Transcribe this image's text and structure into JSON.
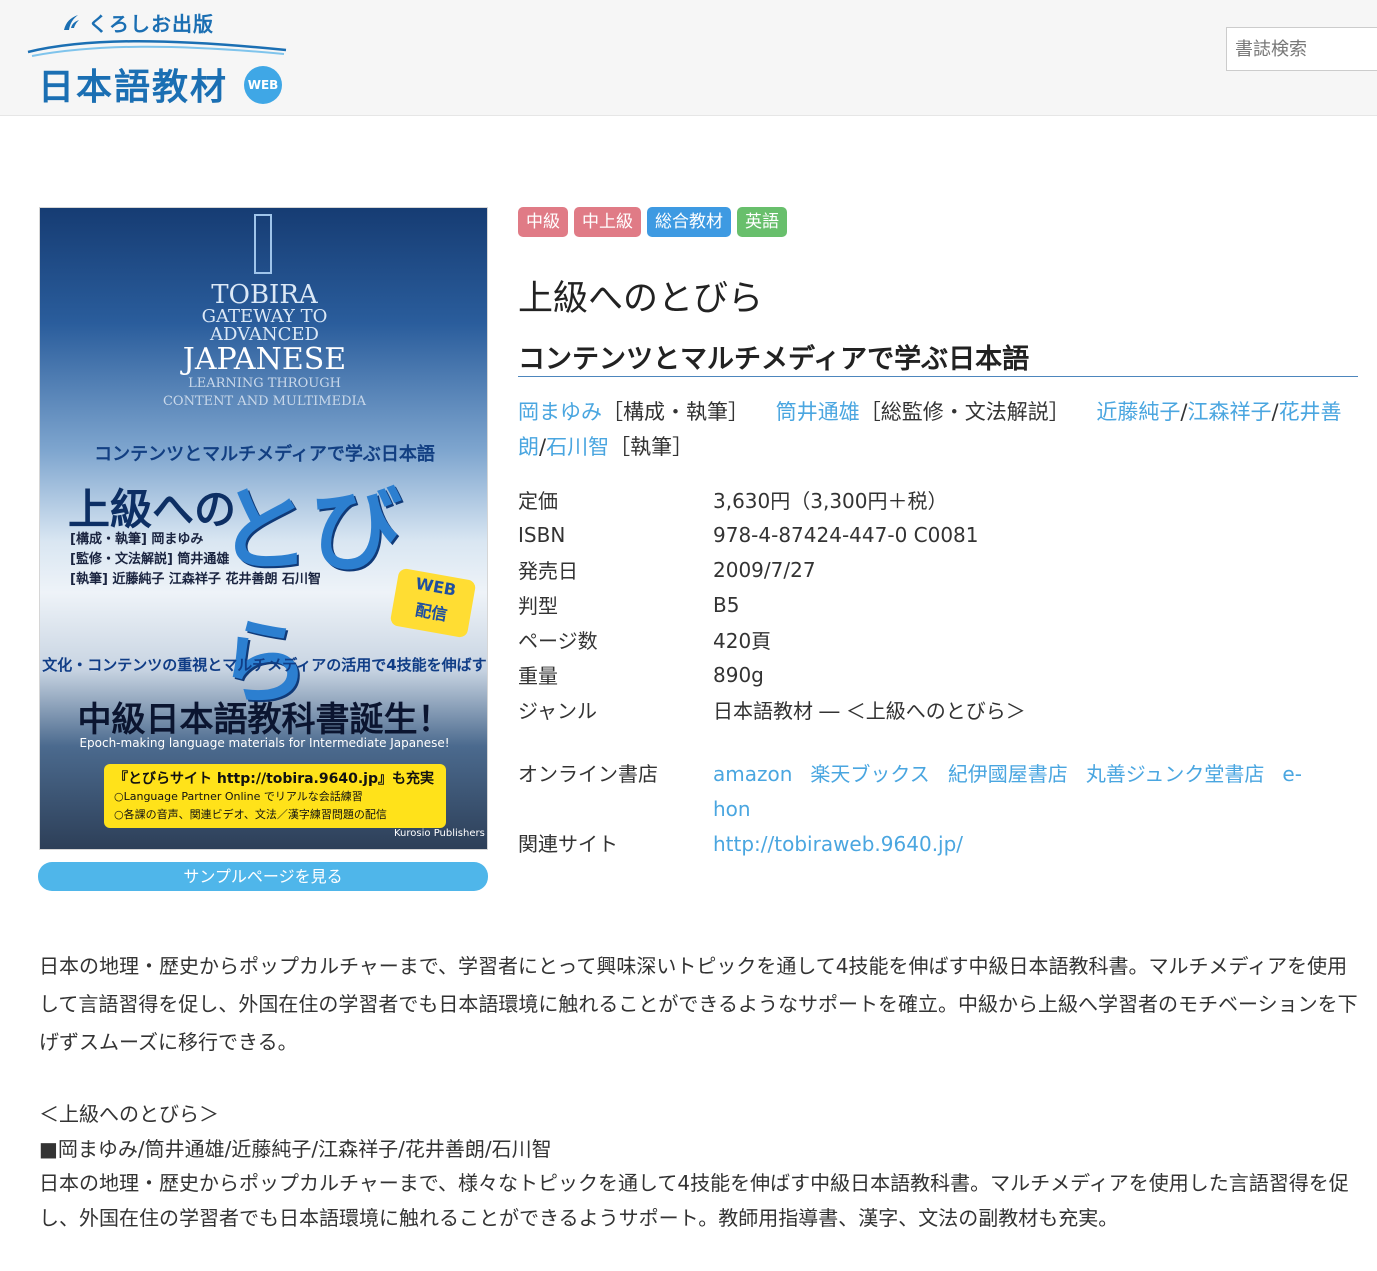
{
  "header": {
    "publisher": "くろしお出版",
    "site_name": "日本語教材",
    "web_badge": "WEB",
    "search_placeholder": "書誌検索"
  },
  "cover": {
    "en_line1": "TOBIRA",
    "en_line2": "GATEWAY TO",
    "en_line3": "ADVANCED",
    "en_line4": "JAPANESE",
    "en_line5": "LEARNING THROUGH",
    "en_line6": "CONTENT AND MULTIMEDIA",
    "subtitle": "コンテンツとマルチメディアで学ぶ日本語",
    "title_a": "上級への",
    "title_b": "とびら",
    "authors_1": "[構成・執筆] 岡まゆみ",
    "authors_2": "[監修・文法解説] 筒井通雄",
    "authors_3": "[執筆] 近藤純子 江森祥子 花井善朗 石川智",
    "web_badge_1": "WEB",
    "web_badge_2": "配信",
    "band": "文化・コンテンツの重視とマルチメディアの活用で4技能を伸ばす",
    "big": "中級日本語教科書誕生！",
    "big_en": "Epoch-making language materials for Intermediate Japanese!",
    "yellow_1": "『とびらサイト http://tobira.9640.jp』も充実",
    "yellow_2": "○Language Partner Online でリアルな会話練習",
    "yellow_3": "○各課の音声、関連ビデオ、文法／漢字練習問題の配信",
    "publisher": "Kurosio Publishers"
  },
  "sample_button": "サンプルページを見る",
  "tags": [
    {
      "label": "中級",
      "color": "#e07b86"
    },
    {
      "label": "中上級",
      "color": "#e07b86"
    },
    {
      "label": "総合教材",
      "color": "#3e9ae2"
    },
    {
      "label": "英語",
      "color": "#68bf6c"
    }
  ],
  "book": {
    "title": "上級へのとびら",
    "subtitle": "コンテンツとマルチメディアで学ぶ日本語"
  },
  "authors": {
    "a1": "岡まゆみ",
    "r1": "［構成・執筆］",
    "a2": "筒井通雄",
    "r2": "［総監修・文法解説］",
    "a3": "近藤純子",
    "a4": "江森祥子",
    "a5": "花井善朗",
    "a6": "石川智",
    "r3": "［執筆］",
    "sep": "/"
  },
  "specs": {
    "price_label": "定価",
    "price": "3,630円（3,300円＋税）",
    "isbn_label": "ISBN",
    "isbn": "978-4-87424-447-0 C0081",
    "date_label": "発売日",
    "date": "2009/7/27",
    "size_label": "判型",
    "size": "B5",
    "pages_label": "ページ数",
    "pages": "420頁",
    "weight_label": "重量",
    "weight": "890g",
    "genre_label": "ジャンル",
    "genre": "日本語教材 ― ＜上級へのとびら＞"
  },
  "online": {
    "label": "オンライン書店",
    "stores": [
      "amazon",
      "楽天ブックス",
      "紀伊國屋書店",
      "丸善ジュンク堂書店",
      "e-hon"
    ]
  },
  "related": {
    "label": "関連サイト",
    "url": "http://tobiraweb.9640.jp/"
  },
  "description": "日本の地理・歴史からポップカルチャーまで、学習者にとって興味深いトピックを通して4技能を伸ばす中級日本語教科書。マルチメディアを使用して言語習得を促し、外国在住の学習者でも日本語環境に触れることができるようなサポートを確立。中級から上級へ学習者のモチベーションを下げずスムーズに移行できる。",
  "series": {
    "name": "＜上級へのとびら＞",
    "authors": "■岡まゆみ/筒井通雄/近藤純子/江森祥子/花井善朗/石川智",
    "text": "日本の地理・歴史からポップカルチャーまで、様々なトピックを通して4技能を伸ばす中級日本語教科書。マルチメディアを使用した言語習得を促し、外国在住の学習者でも日本語環境に触れることができるようサポート。教師用指導書、漢字、文法の副教材も充実。"
  }
}
